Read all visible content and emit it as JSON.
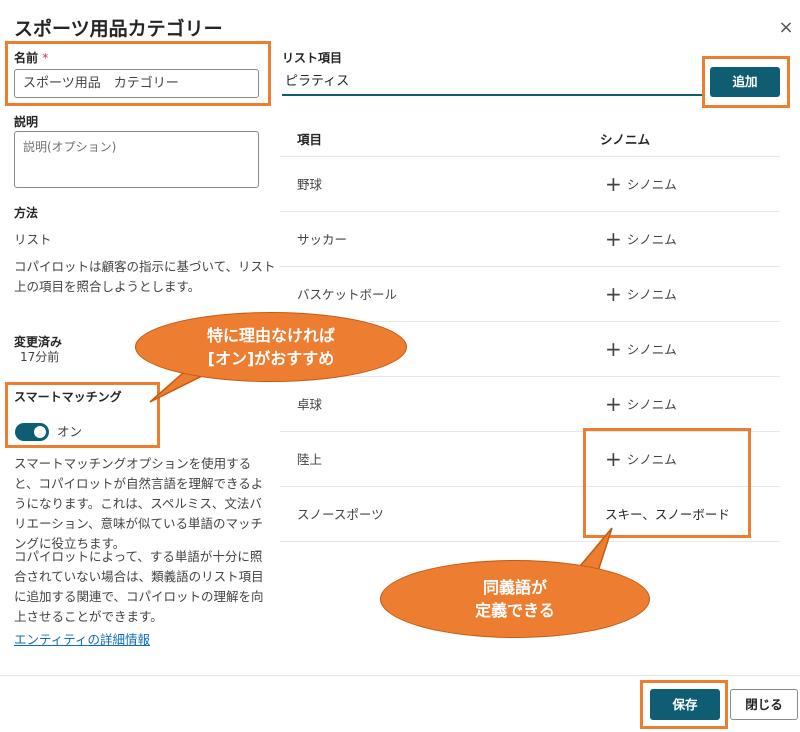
{
  "dialog": {
    "title": "スポーツ用品カテゴリー",
    "close_symbol": "×"
  },
  "left": {
    "name_label": "名前",
    "required_mark": "*",
    "name_value": "スポーツ用品　カテゴリー",
    "desc_label": "説明",
    "desc_placeholder": "説明(オプション)",
    "method_label": "方法",
    "method_value": "リスト",
    "method_desc_1": "コパイロットは顧客の指示に基づいて、リスト",
    "method_desc_2": "上の項目を照合しようとします。",
    "modified_label": "変更済み",
    "modified_value": "17分前",
    "smart_label": "スマートマッチング",
    "smart_state": "オン",
    "smart_desc_lines": [
      "スマートマッチングオプションを使用する",
      "と、コパイロットが自然言語を理解できるよ",
      "うになります。これは、スペルミス、文法バ",
      "リエーション、意味が似ている単語のマッチ",
      "ングに役立ちます。"
    ],
    "syn_desc_lines": [
      "コパイロットによって、する単語が十分に照",
      "合されていない場合は、類義語のリスト項目",
      "に追加する関連で、コパイロットの理解を向",
      "上させることができます。"
    ],
    "details_link": "エンティティの詳細情報"
  },
  "right": {
    "list_label": "リスト項目",
    "item_input_value": "ピラティス",
    "add_label": "追加",
    "col_item": "項目",
    "col_synonym": "シノニム",
    "add_synonym_label": "シノニム",
    "rows": [
      {
        "item": "野球"
      },
      {
        "item": "サッカー"
      },
      {
        "item": "バスケットボール"
      },
      {
        "item": ""
      },
      {
        "item": "卓球"
      },
      {
        "item": "陸上"
      },
      {
        "item": "スノースポーツ",
        "synonyms": "スキー、スノーボード"
      }
    ]
  },
  "footer": {
    "save_label": "保存",
    "close_label": "閉じる"
  },
  "callouts": {
    "smart_line1": "特に理由なければ",
    "smart_line2": "[オン]がおすすめ",
    "syn_line1": "同義語が",
    "syn_line2": "定義できる"
  },
  "colors": {
    "accent": "#0f5d73",
    "highlight": "#ed7d31"
  }
}
